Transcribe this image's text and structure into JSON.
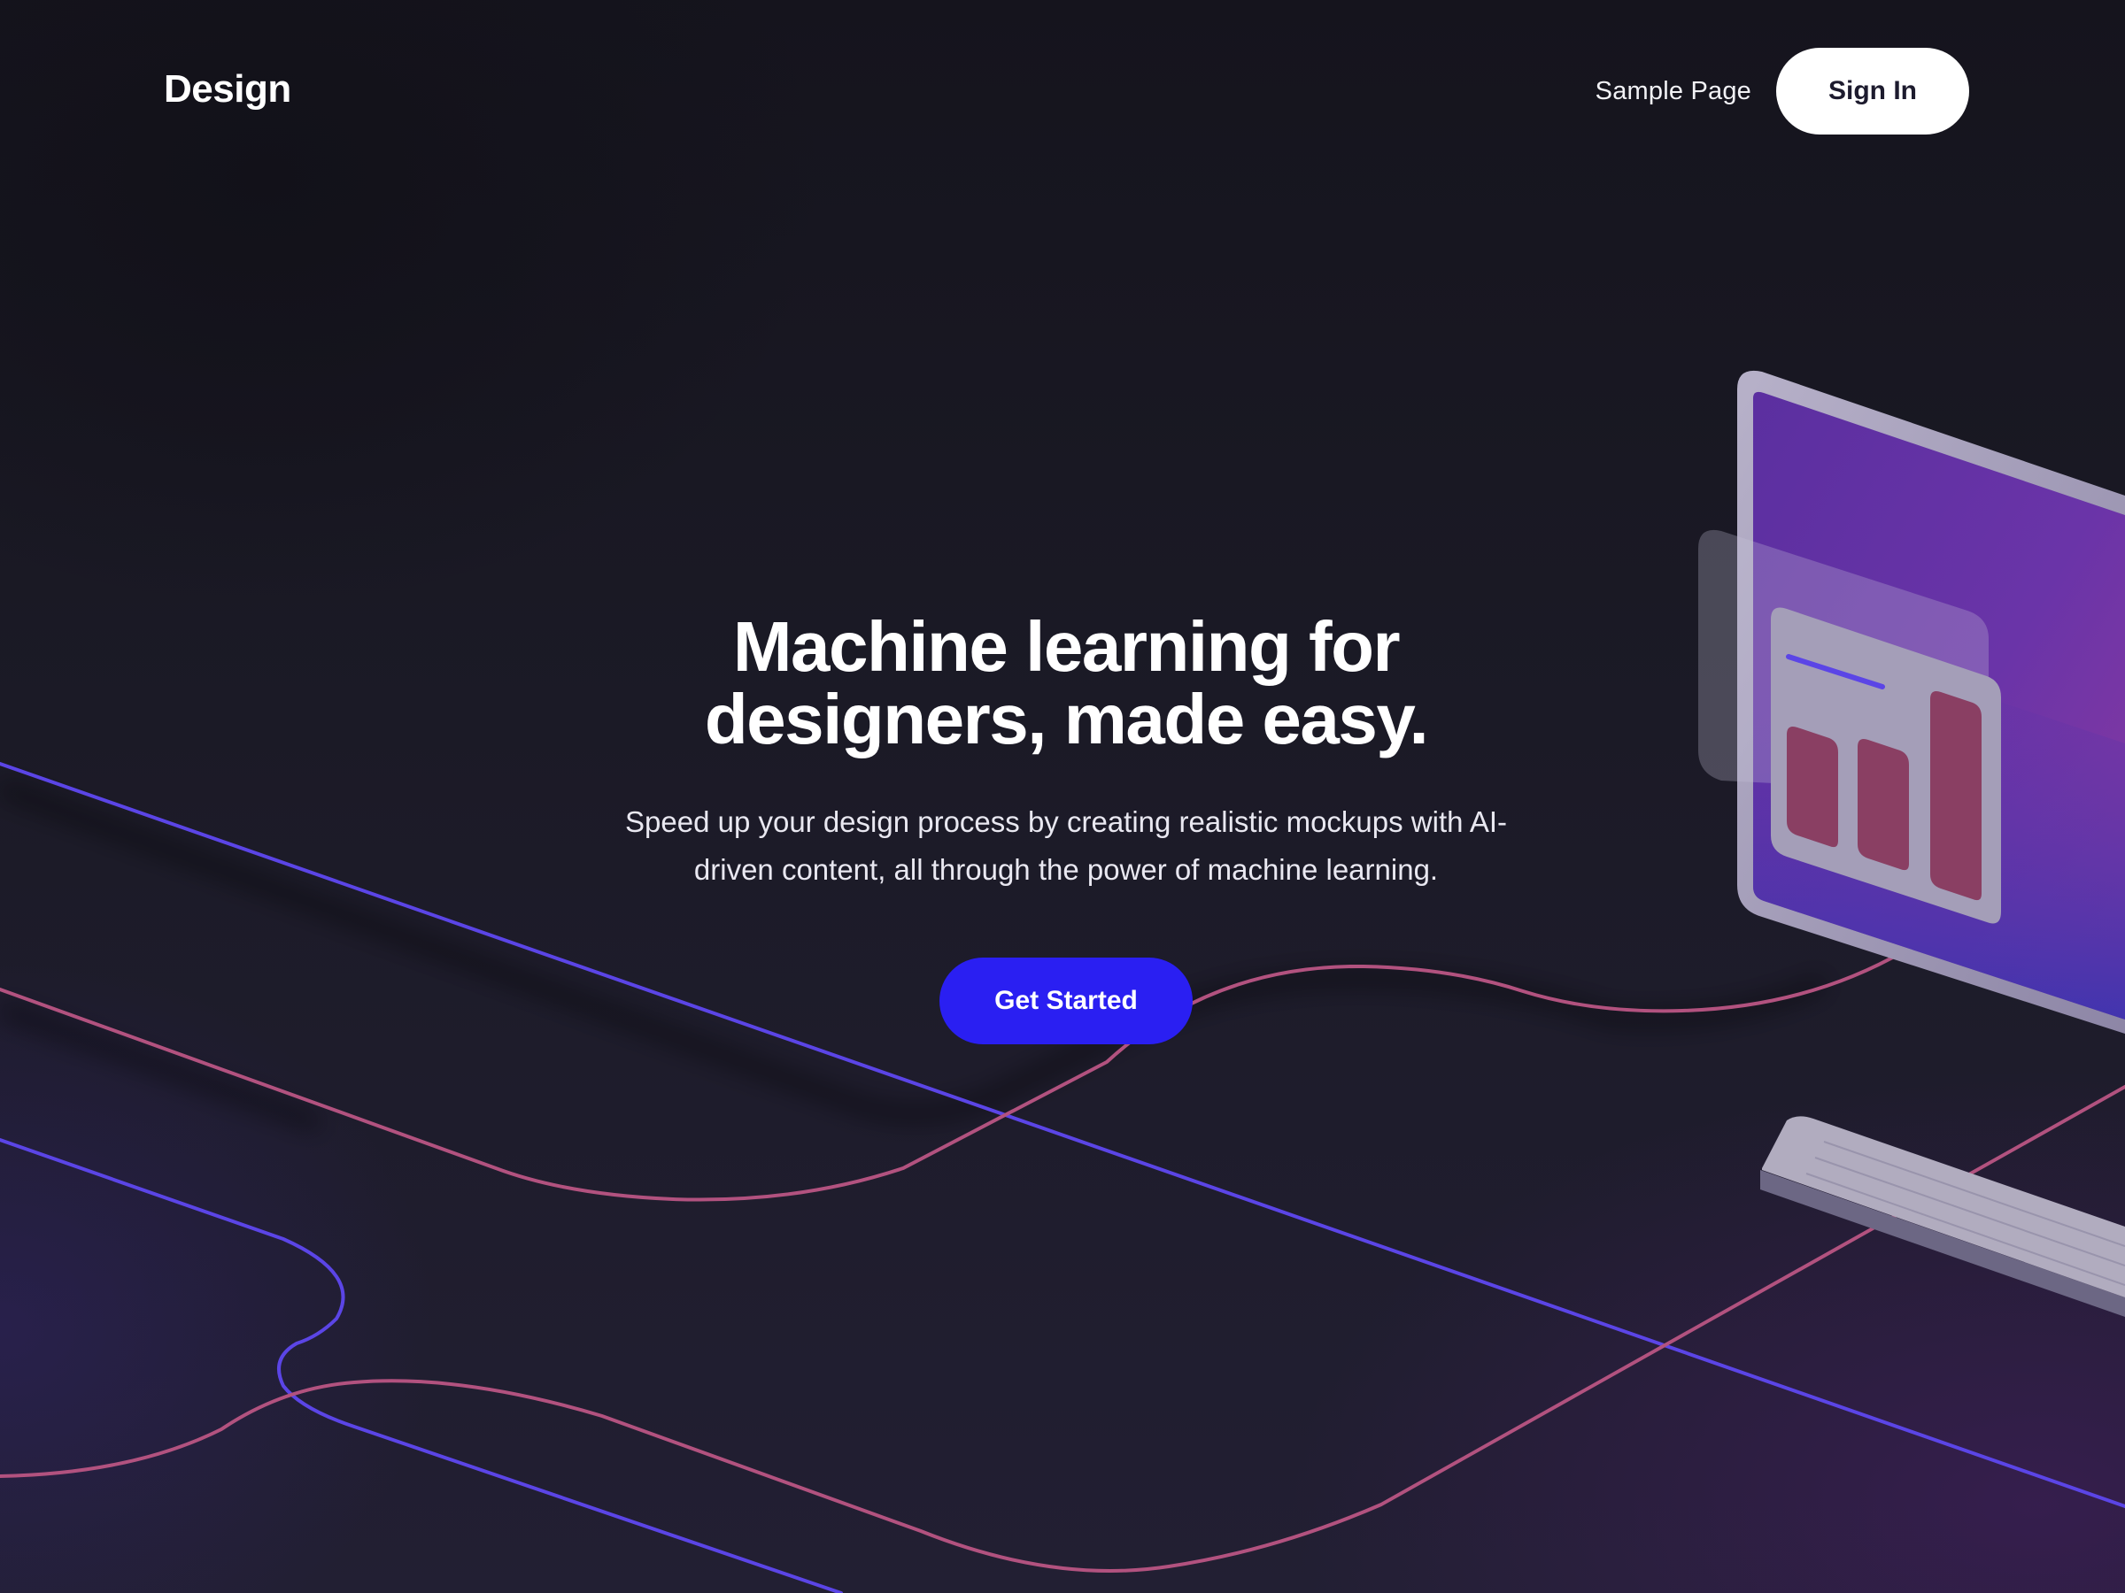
{
  "header": {
    "brand": "Design",
    "nav_link": "Sample Page",
    "signin_label": "Sign In"
  },
  "hero": {
    "title_line1": "Machine learning for",
    "title_line2": "designers, made easy.",
    "subtitle": "Speed up your design process by creating realistic mockups with AI-driven content, all through the power of machine learning.",
    "cta_label": "Get Started"
  },
  "illustration": {
    "bars": 3
  },
  "colors": {
    "background": "#16151f",
    "accent": "#2a1ff2",
    "line_blue": "#5b45e6",
    "line_pink": "#b2527f",
    "screen_purple": "#6a34a8",
    "bar_color": "#8a3f63"
  }
}
